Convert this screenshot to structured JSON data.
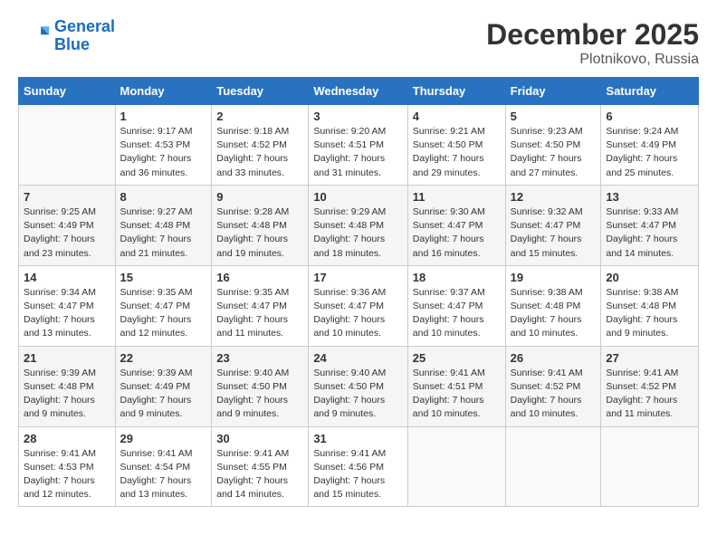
{
  "header": {
    "logo_line1": "General",
    "logo_line2": "Blue",
    "month_title": "December 2025",
    "location": "Plotnikovo, Russia"
  },
  "days_of_week": [
    "Sunday",
    "Monday",
    "Tuesday",
    "Wednesday",
    "Thursday",
    "Friday",
    "Saturday"
  ],
  "weeks": [
    [
      {
        "day": "",
        "info": ""
      },
      {
        "day": "1",
        "info": "Sunrise: 9:17 AM\nSunset: 4:53 PM\nDaylight: 7 hours\nand 36 minutes."
      },
      {
        "day": "2",
        "info": "Sunrise: 9:18 AM\nSunset: 4:52 PM\nDaylight: 7 hours\nand 33 minutes."
      },
      {
        "day": "3",
        "info": "Sunrise: 9:20 AM\nSunset: 4:51 PM\nDaylight: 7 hours\nand 31 minutes."
      },
      {
        "day": "4",
        "info": "Sunrise: 9:21 AM\nSunset: 4:50 PM\nDaylight: 7 hours\nand 29 minutes."
      },
      {
        "day": "5",
        "info": "Sunrise: 9:23 AM\nSunset: 4:50 PM\nDaylight: 7 hours\nand 27 minutes."
      },
      {
        "day": "6",
        "info": "Sunrise: 9:24 AM\nSunset: 4:49 PM\nDaylight: 7 hours\nand 25 minutes."
      }
    ],
    [
      {
        "day": "7",
        "info": "Sunrise: 9:25 AM\nSunset: 4:49 PM\nDaylight: 7 hours\nand 23 minutes."
      },
      {
        "day": "8",
        "info": "Sunrise: 9:27 AM\nSunset: 4:48 PM\nDaylight: 7 hours\nand 21 minutes."
      },
      {
        "day": "9",
        "info": "Sunrise: 9:28 AM\nSunset: 4:48 PM\nDaylight: 7 hours\nand 19 minutes."
      },
      {
        "day": "10",
        "info": "Sunrise: 9:29 AM\nSunset: 4:48 PM\nDaylight: 7 hours\nand 18 minutes."
      },
      {
        "day": "11",
        "info": "Sunrise: 9:30 AM\nSunset: 4:47 PM\nDaylight: 7 hours\nand 16 minutes."
      },
      {
        "day": "12",
        "info": "Sunrise: 9:32 AM\nSunset: 4:47 PM\nDaylight: 7 hours\nand 15 minutes."
      },
      {
        "day": "13",
        "info": "Sunrise: 9:33 AM\nSunset: 4:47 PM\nDaylight: 7 hours\nand 14 minutes."
      }
    ],
    [
      {
        "day": "14",
        "info": "Sunrise: 9:34 AM\nSunset: 4:47 PM\nDaylight: 7 hours\nand 13 minutes."
      },
      {
        "day": "15",
        "info": "Sunrise: 9:35 AM\nSunset: 4:47 PM\nDaylight: 7 hours\nand 12 minutes."
      },
      {
        "day": "16",
        "info": "Sunrise: 9:35 AM\nSunset: 4:47 PM\nDaylight: 7 hours\nand 11 minutes."
      },
      {
        "day": "17",
        "info": "Sunrise: 9:36 AM\nSunset: 4:47 PM\nDaylight: 7 hours\nand 10 minutes."
      },
      {
        "day": "18",
        "info": "Sunrise: 9:37 AM\nSunset: 4:47 PM\nDaylight: 7 hours\nand 10 minutes."
      },
      {
        "day": "19",
        "info": "Sunrise: 9:38 AM\nSunset: 4:48 PM\nDaylight: 7 hours\nand 10 minutes."
      },
      {
        "day": "20",
        "info": "Sunrise: 9:38 AM\nSunset: 4:48 PM\nDaylight: 7 hours\nand 9 minutes."
      }
    ],
    [
      {
        "day": "21",
        "info": "Sunrise: 9:39 AM\nSunset: 4:48 PM\nDaylight: 7 hours\nand 9 minutes."
      },
      {
        "day": "22",
        "info": "Sunrise: 9:39 AM\nSunset: 4:49 PM\nDaylight: 7 hours\nand 9 minutes."
      },
      {
        "day": "23",
        "info": "Sunrise: 9:40 AM\nSunset: 4:50 PM\nDaylight: 7 hours\nand 9 minutes."
      },
      {
        "day": "24",
        "info": "Sunrise: 9:40 AM\nSunset: 4:50 PM\nDaylight: 7 hours\nand 9 minutes."
      },
      {
        "day": "25",
        "info": "Sunrise: 9:41 AM\nSunset: 4:51 PM\nDaylight: 7 hours\nand 10 minutes."
      },
      {
        "day": "26",
        "info": "Sunrise: 9:41 AM\nSunset: 4:52 PM\nDaylight: 7 hours\nand 10 minutes."
      },
      {
        "day": "27",
        "info": "Sunrise: 9:41 AM\nSunset: 4:52 PM\nDaylight: 7 hours\nand 11 minutes."
      }
    ],
    [
      {
        "day": "28",
        "info": "Sunrise: 9:41 AM\nSunset: 4:53 PM\nDaylight: 7 hours\nand 12 minutes."
      },
      {
        "day": "29",
        "info": "Sunrise: 9:41 AM\nSunset: 4:54 PM\nDaylight: 7 hours\nand 13 minutes."
      },
      {
        "day": "30",
        "info": "Sunrise: 9:41 AM\nSunset: 4:55 PM\nDaylight: 7 hours\nand 14 minutes."
      },
      {
        "day": "31",
        "info": "Sunrise: 9:41 AM\nSunset: 4:56 PM\nDaylight: 7 hours\nand 15 minutes."
      },
      {
        "day": "",
        "info": ""
      },
      {
        "day": "",
        "info": ""
      },
      {
        "day": "",
        "info": ""
      }
    ]
  ]
}
